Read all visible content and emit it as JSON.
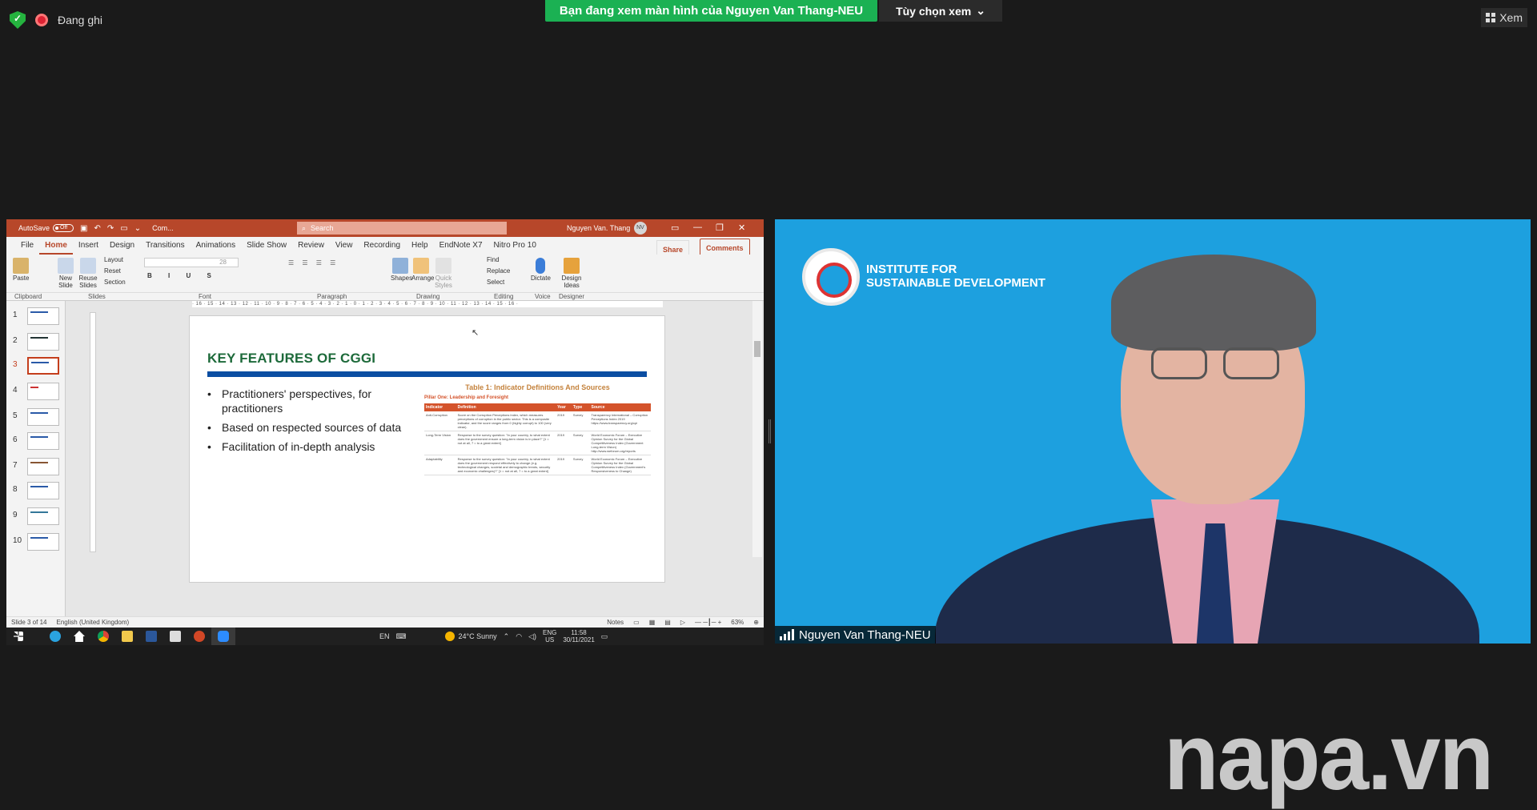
{
  "zoom": {
    "recording_label": "Đang ghi",
    "share_banner": "Bạn đang xem màn hình của Nguyen Van Thang-NEU",
    "view_options": "Tùy chọn xem",
    "view_button": "Xem",
    "participant_name": "Nguyen Van Thang-NEU",
    "watermark": "napa.vn"
  },
  "ppt": {
    "autosave": "AutoSave",
    "autosave_state": "Off",
    "doc_name": "Com...",
    "search_placeholder": "Search",
    "user_name": "Nguyen Van. Thang",
    "user_initials": "NV",
    "tabs": [
      "File",
      "Home",
      "Insert",
      "Design",
      "Transitions",
      "Animations",
      "Slide Show",
      "Review",
      "View",
      "Recording",
      "Help",
      "EndNote X7",
      "Nitro Pro 10"
    ],
    "share": "Share",
    "comments": "Comments",
    "ribbon": {
      "paste": "Paste",
      "new_slide": "New Slide",
      "reuse_slides": "Reuse Slides",
      "layout": "Layout",
      "reset": "Reset",
      "section": "Section",
      "font_size": "28",
      "shapes": "Shapes",
      "arrange": "Arrange",
      "quick_styles": "Quick Styles",
      "find": "Find",
      "replace": "Replace",
      "select": "Select",
      "dictate": "Dictate",
      "design_ideas": "Design Ideas"
    },
    "groups": [
      "Clipboard",
      "Slides",
      "Font",
      "Paragraph",
      "Drawing",
      "Editing",
      "Voice",
      "Designer"
    ],
    "ruler": "· 16 · 15 · 14 · 13 · 12 · 11 · 10 · 9 · 8 · 7 · 6 · 5 · 4 · 3 · 2 · 1 · 0 · 1 · 2 · 3 · 4 · 5 · 6 · 7 · 8 · 9 · 10 · 11 · 12 · 13 · 14 · 15 · 16 ·",
    "thumb_numbers": [
      "1",
      "2",
      "3",
      "4",
      "5",
      "6",
      "7",
      "8",
      "9",
      "10"
    ],
    "slide": {
      "title": "KEY FEATURES OF CGGI",
      "bullets": [
        "Practitioners' perspectives, for practitioners",
        "Based on respected sources of data",
        "Facilitation of in-depth analysis"
      ],
      "table_title": "Table 1: Indicator Definitions And Sources",
      "pillar": "Pillar One: Leadership and Foresight",
      "headers": [
        "Indicator",
        "Definition",
        "Year",
        "Type",
        "Source"
      ],
      "rows": [
        [
          "Anti-Corruption",
          "Score on the Corruption Perceptions Index, which measures perceptions of corruption in the public sector. This is a composite indicator, and the score ranges from 0 (highly corrupt) to 100 (very clean).",
          "2019",
          "Survey",
          "Transparency International – Corruption Perceptions Index 2019 https://www.transparency.org/cpi"
        ],
        [
          "Long-Term Vision",
          "Response to the survey question: \"In your country, to what extent does the government ensure a long-term vision is in place?\" [1 = not at all, 7 = to a great extent]",
          "2019",
          "Survey",
          "World Economic Forum – Executive Opinion Survey for the Global Competitiveness Index (Government Long-term Vision) http://www.weforum.org/reports"
        ],
        [
          "Adaptability",
          "Response to the survey question: \"In your country, to what extent does the government respond effectively to change (e.g. technological changes, societal and demographic trends, security and economic challenges)?\" [1 = not at all, 7 = to a great extent]",
          "2019",
          "Survey",
          "World Economic Forum – Executive Opinion Survey for the Global Competitiveness Index (Government's Responsiveness to Change)"
        ]
      ]
    },
    "status": {
      "slide_of": "Slide 3 of 14",
      "language": "English (United Kingdom)",
      "notes": "Notes",
      "zoom": "63%"
    },
    "taskbar": {
      "lang": "EN",
      "weather": "24°C  Sunny",
      "lang2": "ENG",
      "region": "US",
      "time": "11:58",
      "date": "30/11/2021"
    }
  },
  "video": {
    "institute_line1": "INSTITUTE FOR",
    "institute_line2": "SUSTAINABLE DEVELOPMENT"
  }
}
